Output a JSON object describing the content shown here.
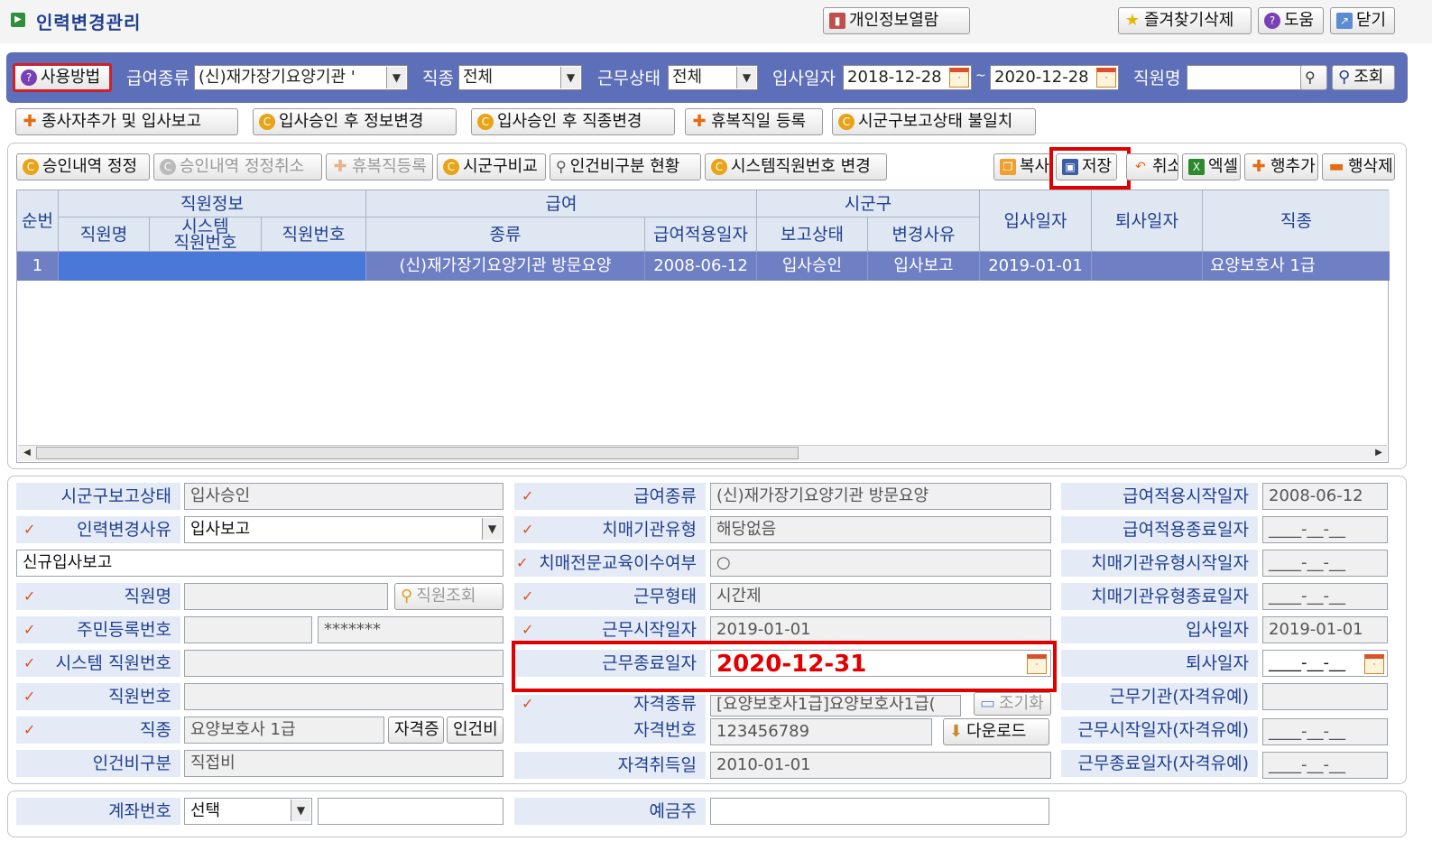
{
  "title": "인력변경관리",
  "header_buttons": {
    "privacy": "개인정보열람",
    "fav_delete": "즐겨찾기삭제",
    "help": "도움",
    "close": "닫기"
  },
  "filter": {
    "usage": "사용방법",
    "pay_type_label": "급여종류",
    "pay_type_value": "(신)재가장기요양기관 '",
    "job_label": "직종",
    "job_value": "전체",
    "status_label": "근무상태",
    "status_value": "전체",
    "hire_label": "입사일자",
    "hire_from": "2018-12-28",
    "hire_sep": "~",
    "hire_to": "2020-12-28",
    "name_label": "직원명",
    "name_value": "",
    "search": "조회"
  },
  "action_buttons": {
    "add_worker": "종사자추가 및 입사보고",
    "info_change": "입사승인 후 정보변경",
    "job_change": "입사승인 후 직종변경",
    "leave_register": "휴복직일 등록",
    "mismatch": "시군구보고상태 불일치"
  },
  "grid_toolbar": {
    "approve_fix": "승인내역 정정",
    "approve_cancel": "승인내역 정정취소",
    "leave_reg": "휴복직등록",
    "compare": "시군구비교",
    "labor_status": "인건비구분 현황",
    "sysno_change": "시스템직원번호 변경",
    "copy": "복사",
    "save": "저장",
    "cancel": "취소",
    "excel": "엑셀",
    "add_row": "행추가",
    "del_row": "행삭제"
  },
  "grid": {
    "headers": {
      "seq": "순번",
      "staff_info": "직원정보",
      "staff_name": "직원명",
      "sys_no": "시스템\n직원번호",
      "staff_no": "직원번호",
      "pay": "급여",
      "pay_type": "종류",
      "pay_date": "급여적용일자",
      "sigungu": "시군구",
      "report_status": "보고상태",
      "change_reason": "변경사유",
      "hire_date": "입사일자",
      "retire_date": "퇴사일자",
      "job": "직종"
    },
    "rows": [
      {
        "seq": "1",
        "pay_type": "(신)재가장기요양기관 방문요양",
        "pay_date": "2008-06-12",
        "report_status": "입사승인",
        "change_reason": "입사보고",
        "hire_date": "2019-01-01",
        "retire_date": "",
        "job": "요양보호사 1급"
      }
    ]
  },
  "form": {
    "col1": {
      "report_status_label": "시군구보고상태",
      "report_status_value": "입사승인",
      "reason_label": "인력변경사유",
      "reason_value": "입사보고",
      "reason_detail": "신규입사보고",
      "name_label": "직원명",
      "staff_search": "직원조회",
      "rrn_label": "주민등록번호",
      "rrn_masked": "*******",
      "sysno_label": "시스템 직원번호",
      "staffno_label": "직원번호",
      "job_label": "직종",
      "job_value": "요양보호사 1급",
      "qual_btn": "자격증",
      "labor_btn": "인건비",
      "labor_label": "인건비구분",
      "labor_value": "직접비"
    },
    "col2": {
      "pay_type_label": "급여종류",
      "pay_type_value": "(신)재가장기요양기관 방문요양",
      "dementia_type_label": "치매기관유형",
      "dementia_type_value": "해당없음",
      "dementia_edu_label": "치매전문교육이수여부",
      "dementia_edu_value": "○",
      "work_type_label": "근무형태",
      "work_type_value": "시간제",
      "work_start_label": "근무시작일자",
      "work_start_value": "2019-01-01",
      "work_end_label": "근무종료일자",
      "work_end_value": "2020-12-31",
      "qual_type_label": "자격종류",
      "qual_type_value": "[요양보호사1급]요양보호사1급(",
      "qual_search": "조기화",
      "qual_no_label": "자격번호",
      "qual_no_value": "123456789",
      "download": "다운로드",
      "qual_date_label": "자격취득일",
      "qual_date_value": "2010-01-01"
    },
    "col3": {
      "pay_start_label": "급여적용시작일자",
      "pay_start_value": "2008-06-12",
      "pay_end_label": "급여적용종료일자",
      "pay_end_value": "____-__-__",
      "dem_start_label": "치매기관유형시작일자",
      "dem_start_value": "____-__-__",
      "dem_end_label": "치매기관유형종료일자",
      "dem_end_value": "____-__-__",
      "hire_label": "입사일자",
      "hire_value": "2019-01-01",
      "retire_label": "퇴사일자",
      "retire_value": "____-__-__",
      "work_org_label": "근무기관(자격유예)",
      "work_org_value": "",
      "ws_label": "근무시작일자(자격유예)",
      "ws_value": "____-__-__",
      "we_label": "근무종료일자(자격유예)",
      "we_value": "____-__-__"
    },
    "account": {
      "account_label": "계좌번호",
      "bank_value": "선택",
      "depositor_label": "예금주"
    }
  },
  "colors": {
    "filter_bar": "#5d6fb8",
    "selected_row": "#6f7fc4",
    "highlight": "#e00000",
    "label_text": "#1f3f8f"
  }
}
